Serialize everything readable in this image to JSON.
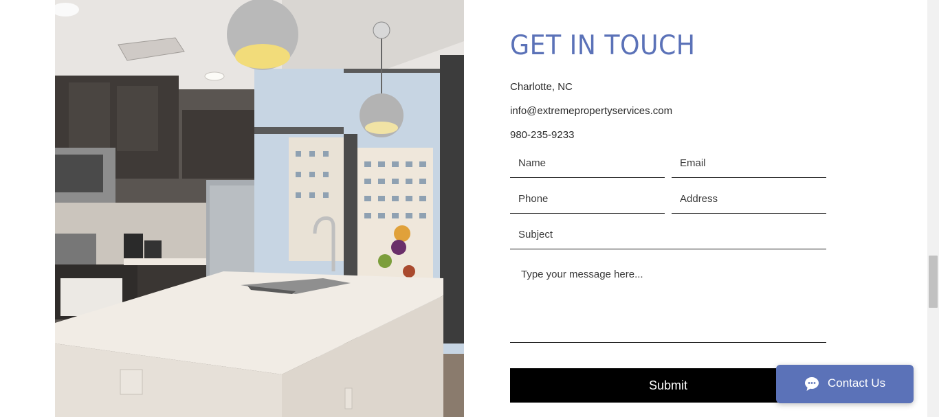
{
  "contact": {
    "heading": "GET IN TOUCH",
    "location": "Charlotte, NC",
    "email": "info@extremepropertyservices.com",
    "phone": "980-235-9233"
  },
  "form": {
    "name_label": "Name",
    "email_label": "Email",
    "phone_label": "Phone",
    "address_label": "Address",
    "subject_label": "Subject",
    "message_placeholder": "Type your message here...",
    "submit_label": "Submit"
  },
  "widget": {
    "label": "Contact Us",
    "icon": "chat-bubble-icon",
    "color": "#5b72b8"
  },
  "colors": {
    "heading": "#5b72b8",
    "button": "#000000"
  }
}
